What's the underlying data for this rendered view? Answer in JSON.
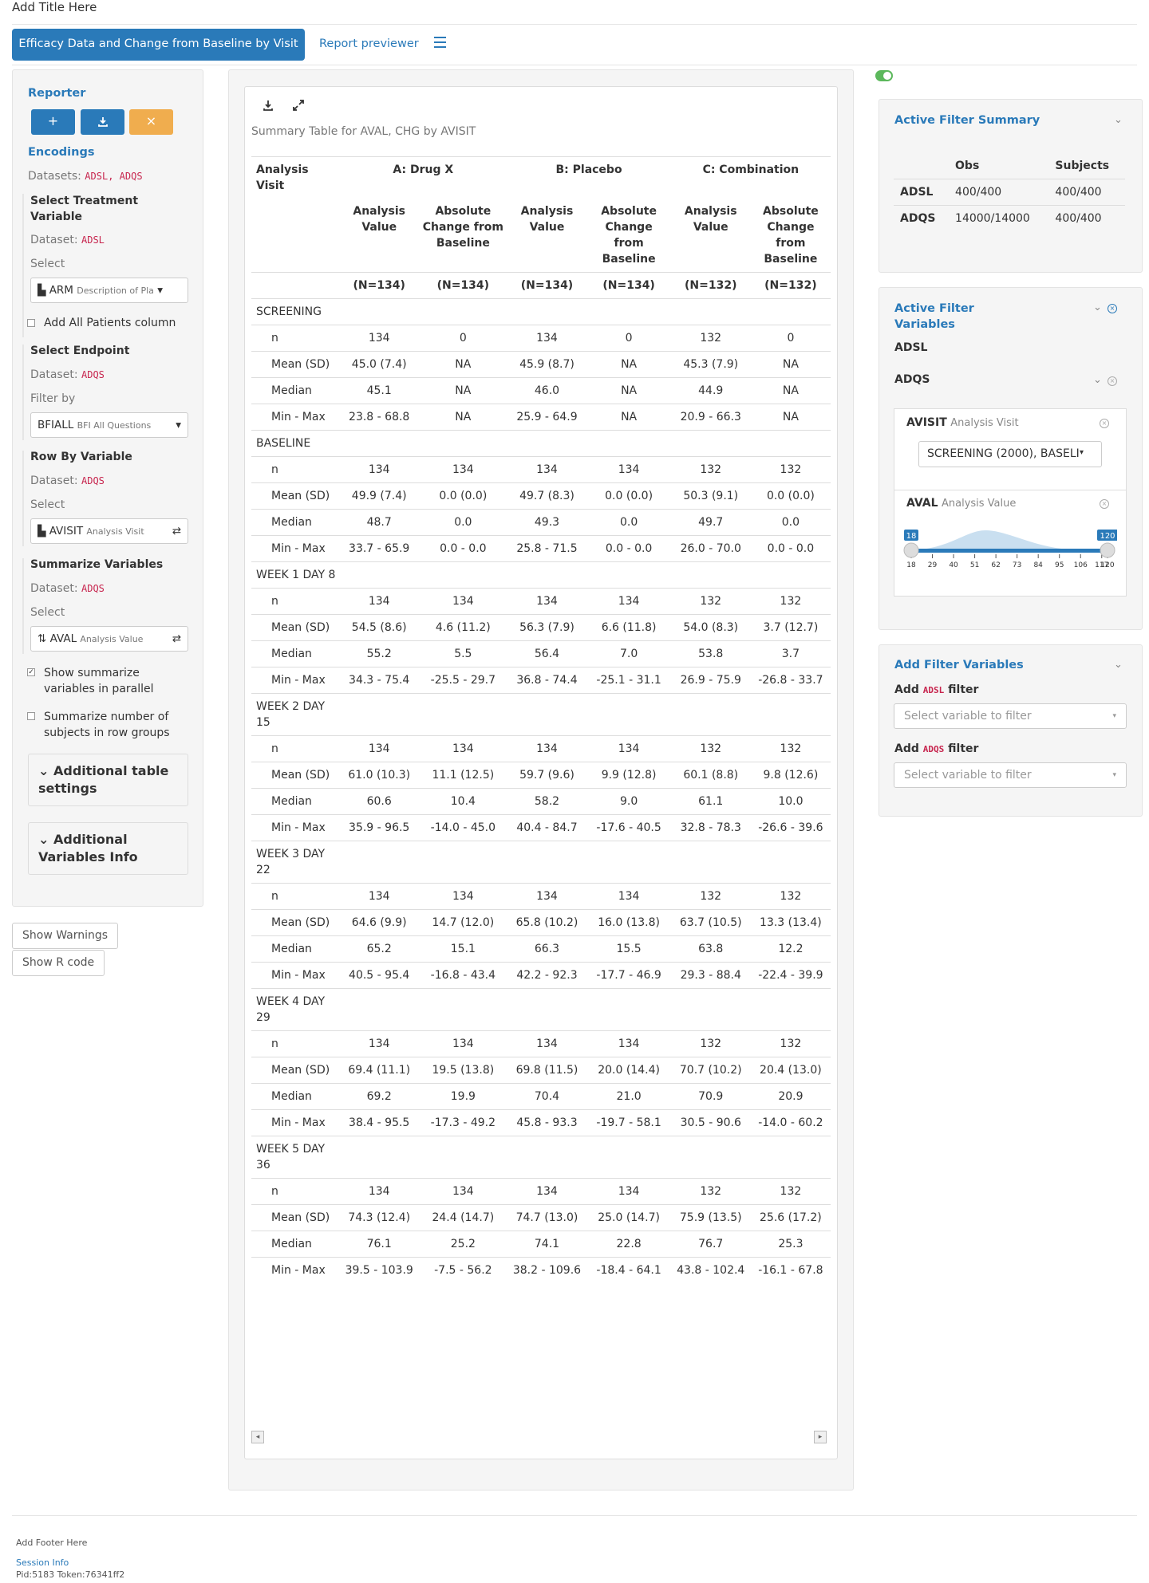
{
  "app": {
    "title": "Add Title Here"
  },
  "tabs": {
    "main": "Efficacy Data and Change from Baseline by Visit",
    "previewer": "Report previewer"
  },
  "encodings": {
    "reporter_title": "Reporter",
    "encodings_title": "Encodings",
    "datasets_label": "Datasets:",
    "datasets_value": "ADSL, ADQS",
    "treatment": {
      "title": "Select Treatment Variable",
      "dataset_label": "Dataset:",
      "dataset": "ADSL",
      "select_label": "Select",
      "value": "ARM",
      "value_desc": "Description of Pla"
    },
    "add_all_patients": "Add All Patients column",
    "endpoint": {
      "title": "Select Endpoint",
      "dataset_label": "Dataset:",
      "dataset": "ADQS",
      "filter_label": "Filter by",
      "value": "BFIALL",
      "value_desc": "BFI All Questions"
    },
    "row_by": {
      "title": "Row By Variable",
      "dataset_label": "Dataset:",
      "dataset": "ADQS",
      "select_label": "Select",
      "value": "AVISIT",
      "value_desc": "Analysis Visit"
    },
    "summarize": {
      "title": "Summarize Variables",
      "dataset_label": "Dataset:",
      "dataset": "ADQS",
      "select_label": "Select",
      "value": "AVAL",
      "value_desc": "Analysis Value"
    },
    "show_parallel": "Show summarize variables in parallel",
    "summarize_number": "Summarize number of subjects in row groups",
    "additional_table": "Additional table settings",
    "additional_vars": "Additional Variables Info",
    "show_warnings": "Show Warnings",
    "show_r_code": "Show R code"
  },
  "table": {
    "caption": "Summary Table for AVAL, CHG by AVISIT",
    "header_row_label": "Analysis Visit",
    "arms": [
      "A: Drug X",
      "B: Placebo",
      "C: Combination"
    ],
    "sub_headers": [
      "Analysis Value",
      "Absolute Change from Baseline",
      "Analysis Value",
      "Absolute Change from Baseline",
      "Analysis Value",
      "Absolute Change from Baseline"
    ],
    "ns": [
      "(N=134)",
      "(N=134)",
      "(N=134)",
      "(N=134)",
      "(N=132)",
      "(N=132)"
    ],
    "groups": [
      {
        "name": "SCREENING",
        "rows": [
          {
            "label": "n",
            "cells": [
              "134",
              "0",
              "134",
              "0",
              "132",
              "0"
            ]
          },
          {
            "label": "Mean (SD)",
            "cells": [
              "45.0 (7.4)",
              "NA",
              "45.9 (8.7)",
              "NA",
              "45.3 (7.9)",
              "NA"
            ]
          },
          {
            "label": "Median",
            "cells": [
              "45.1",
              "NA",
              "46.0",
              "NA",
              "44.9",
              "NA"
            ]
          },
          {
            "label": "Min - Max",
            "cells": [
              "23.8 - 68.8",
              "NA",
              "25.9 - 64.9",
              "NA",
              "20.9 - 66.3",
              "NA"
            ]
          }
        ]
      },
      {
        "name": "BASELINE",
        "rows": [
          {
            "label": "n",
            "cells": [
              "134",
              "134",
              "134",
              "134",
              "132",
              "132"
            ]
          },
          {
            "label": "Mean (SD)",
            "cells": [
              "49.9 (7.4)",
              "0.0 (0.0)",
              "49.7 (8.3)",
              "0.0 (0.0)",
              "50.3 (9.1)",
              "0.0 (0.0)"
            ]
          },
          {
            "label": "Median",
            "cells": [
              "48.7",
              "0.0",
              "49.3",
              "0.0",
              "49.7",
              "0.0"
            ]
          },
          {
            "label": "Min - Max",
            "cells": [
              "33.7 - 65.9",
              "0.0 - 0.0",
              "25.8 - 71.5",
              "0.0 - 0.0",
              "26.0 - 70.0",
              "0.0 - 0.0"
            ]
          }
        ]
      },
      {
        "name": "WEEK 1 DAY 8",
        "rows": [
          {
            "label": "n",
            "cells": [
              "134",
              "134",
              "134",
              "134",
              "132",
              "132"
            ]
          },
          {
            "label": "Mean (SD)",
            "cells": [
              "54.5 (8.6)",
              "4.6 (11.2)",
              "56.3 (7.9)",
              "6.6 (11.8)",
              "54.0 (8.3)",
              "3.7 (12.7)"
            ]
          },
          {
            "label": "Median",
            "cells": [
              "55.2",
              "5.5",
              "56.4",
              "7.0",
              "53.8",
              "3.7"
            ]
          },
          {
            "label": "Min - Max",
            "cells": [
              "34.3 - 75.4",
              "-25.5 - 29.7",
              "36.8 - 74.4",
              "-25.1 - 31.1",
              "26.9 - 75.9",
              "-26.8 - 33.7"
            ]
          }
        ]
      },
      {
        "name": "WEEK 2 DAY 15",
        "rows": [
          {
            "label": "n",
            "cells": [
              "134",
              "134",
              "134",
              "134",
              "132",
              "132"
            ]
          },
          {
            "label": "Mean (SD)",
            "cells": [
              "61.0 (10.3)",
              "11.1 (12.5)",
              "59.7 (9.6)",
              "9.9 (12.8)",
              "60.1 (8.8)",
              "9.8 (12.6)"
            ]
          },
          {
            "label": "Median",
            "cells": [
              "60.6",
              "10.4",
              "58.2",
              "9.0",
              "61.1",
              "10.0"
            ]
          },
          {
            "label": "Min - Max",
            "cells": [
              "35.9 - 96.5",
              "-14.0 - 45.0",
              "40.4 - 84.7",
              "-17.6 - 40.5",
              "32.8 - 78.3",
              "-26.6 - 39.6"
            ]
          }
        ]
      },
      {
        "name": "WEEK 3 DAY 22",
        "rows": [
          {
            "label": "n",
            "cells": [
              "134",
              "134",
              "134",
              "134",
              "132",
              "132"
            ]
          },
          {
            "label": "Mean (SD)",
            "cells": [
              "64.6 (9.9)",
              "14.7 (12.0)",
              "65.8 (10.2)",
              "16.0 (13.8)",
              "63.7 (10.5)",
              "13.3 (13.4)"
            ]
          },
          {
            "label": "Median",
            "cells": [
              "65.2",
              "15.1",
              "66.3",
              "15.5",
              "63.8",
              "12.2"
            ]
          },
          {
            "label": "Min - Max",
            "cells": [
              "40.5 - 95.4",
              "-16.8 - 43.4",
              "42.2 - 92.3",
              "-17.7 - 46.9",
              "29.3 - 88.4",
              "-22.4 - 39.9"
            ]
          }
        ]
      },
      {
        "name": "WEEK 4 DAY 29",
        "rows": [
          {
            "label": "n",
            "cells": [
              "134",
              "134",
              "134",
              "134",
              "132",
              "132"
            ]
          },
          {
            "label": "Mean (SD)",
            "cells": [
              "69.4 (11.1)",
              "19.5 (13.8)",
              "69.8 (11.5)",
              "20.0 (14.4)",
              "70.7 (10.2)",
              "20.4 (13.0)"
            ]
          },
          {
            "label": "Median",
            "cells": [
              "69.2",
              "19.9",
              "70.4",
              "21.0",
              "70.9",
              "20.9"
            ]
          },
          {
            "label": "Min - Max",
            "cells": [
              "38.4 - 95.5",
              "-17.3 - 49.2",
              "45.8 - 93.3",
              "-19.7 - 58.1",
              "30.5 - 90.6",
              "-14.0 - 60.2"
            ]
          }
        ]
      },
      {
        "name": "WEEK 5 DAY 36",
        "rows": [
          {
            "label": "n",
            "cells": [
              "134",
              "134",
              "134",
              "134",
              "132",
              "132"
            ]
          },
          {
            "label": "Mean (SD)",
            "cells": [
              "74.3 (12.4)",
              "24.4 (14.7)",
              "74.7 (13.0)",
              "25.0 (14.7)",
              "75.9 (13.5)",
              "25.6 (17.2)"
            ]
          },
          {
            "label": "Median",
            "cells": [
              "76.1",
              "25.2",
              "74.1",
              "22.8",
              "76.7",
              "25.3"
            ]
          },
          {
            "label": "Min - Max",
            "cells": [
              "39.5 - 103.9",
              "-7.5 - 56.2",
              "38.2 - 109.6",
              "-18.4 - 64.1",
              "43.8 - 102.4",
              "-16.1 - 67.8"
            ]
          }
        ]
      }
    ]
  },
  "filter_summary": {
    "title": "Active Filter Summary",
    "columns": [
      "Obs",
      "Subjects"
    ],
    "rows": [
      {
        "name": "ADSL",
        "obs": "400/400",
        "subjects": "400/400"
      },
      {
        "name": "ADQS",
        "obs": "14000/14000",
        "subjects": "400/400"
      }
    ]
  },
  "active_filters": {
    "title": "Active Filter Variables",
    "adsl": "ADSL",
    "adqs": "ADQS",
    "avisit": {
      "name": "AVISIT",
      "desc": "Analysis Visit",
      "value": "SCREENING (2000), BASELI"
    },
    "aval": {
      "name": "AVAL",
      "desc": "Analysis Value",
      "min_value": 18,
      "max_value": 120,
      "ticks": [
        "18",
        "29",
        "40",
        "51",
        "62",
        "73",
        "84",
        "95",
        "106",
        "117",
        "120"
      ]
    }
  },
  "add_filters": {
    "title": "Add Filter Variables",
    "add_label": "Add",
    "filter_label": "filter",
    "adsl": "ADSL",
    "adqs": "ADQS",
    "placeholder": "Select variable to filter"
  },
  "footer": {
    "text": "Add Footer Here",
    "session_info": "Session Info",
    "pid": "Pid:5183 Token:76341ff2"
  },
  "colors": {
    "primary": "#2a7ab9",
    "warning": "#f0ad4e",
    "toggle": "#5cb85c"
  },
  "icons": [
    "menu-icon",
    "plus-icon",
    "download-icon",
    "close-icon",
    "chart-icon",
    "swap-icon",
    "sort-icon",
    "check-icon",
    "chevron-down-icon",
    "expand-icon",
    "circle-x-icon",
    "toggle-icon"
  ]
}
